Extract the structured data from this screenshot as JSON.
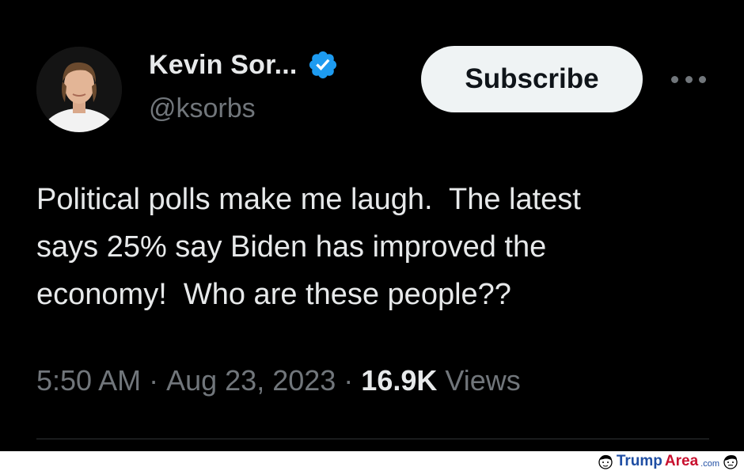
{
  "post": {
    "author": {
      "display_name": "Kevin Sor...",
      "handle": "@ksorbs",
      "verified": true,
      "avatar_icon": "profile-photo-avatar"
    },
    "subscribe_label": "Subscribe",
    "more_icon": "more-options-ellipsis-icon",
    "text_lines": [
      "Political polls make me laugh.  The latest",
      "says 25% say Biden has improved the",
      "economy!  Who are these people??"
    ],
    "time": "5:50 AM",
    "separator": " · ",
    "date": "Aug 23, 2023",
    "views_count": "16.9K",
    "views_label": " Views"
  },
  "watermark": {
    "brand_part1": "Trump",
    "brand_part2": "Area",
    "brand_suffix": ".com",
    "colors": {
      "trump": "#1f4ea3",
      "area": "#c8102e"
    }
  },
  "colors": {
    "background": "#000000",
    "primary_text": "#e7e9ea",
    "secondary_text": "#71767b",
    "verified_badge": "#1d9bf0",
    "subscribe_bg": "#eff3f4"
  }
}
